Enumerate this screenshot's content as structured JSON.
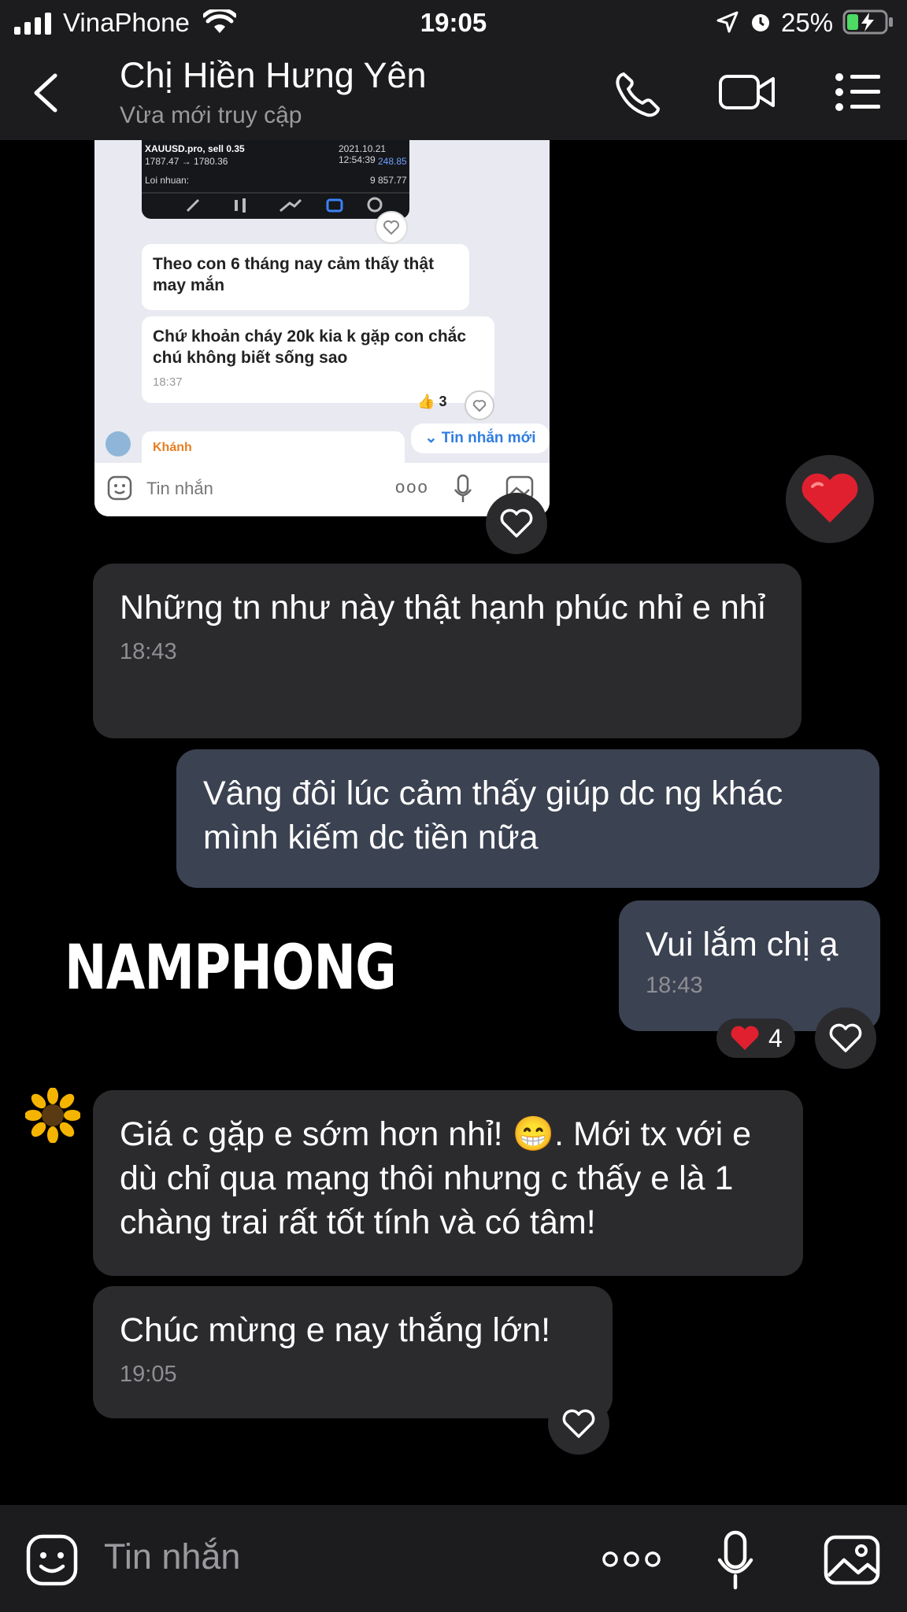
{
  "status_bar": {
    "carrier": "VinaPhone",
    "time": "19:05",
    "battery": "25%"
  },
  "header": {
    "title": "Chị Hiền Hưng Yên",
    "subtitle": "Vừa mới truy cập"
  },
  "screenshot": {
    "ticker": "XAUUSD.pro, sell 0.35",
    "price": "1787.47 → 1780.36",
    "datetime": "2021.10.21 12:54:39",
    "amount": "248.85",
    "profit_label": "Loi nhuan:",
    "profit_value": "9 857.77",
    "msg1": "Theo con 6 tháng nay cảm thấy thật may mắn",
    "msg2": "Chứ khoản cháy 20k kia k gặp con chắc chú không biết sống sao",
    "msg2_time": "18:37",
    "like_count": "3",
    "new_messages": "Tin nhắn mới",
    "sender": "Khánh",
    "input_placeholder": "Tin nhắn"
  },
  "messages": [
    {
      "text": "Những tn như này thật hạnh phúc nhỉ e nhỉ",
      "time": "18:43"
    },
    {
      "text": "Vâng đôi lúc cảm thấy giúp dc ng khác mình kiếm dc tiền nữa"
    },
    {
      "text": "Vui lắm chị ạ",
      "time": "18:43",
      "reaction_count": "4"
    },
    {
      "text": "Giá c gặp e sớm hơn nhỉ! 😁. Mới tx với e dù chỉ qua mạng thôi nhưng c thấy e là 1 chàng trai rất tốt tính và có tâm!"
    },
    {
      "text": "Chúc mừng e nay thắng lớn!",
      "time": "19:05"
    }
  ],
  "watermark": "NAMPHONG",
  "input": {
    "placeholder": "Tin nhắn"
  },
  "colors": {
    "incoming": "#2b2b2e",
    "outgoing": "#3b4252",
    "heart": "#e0202e"
  }
}
